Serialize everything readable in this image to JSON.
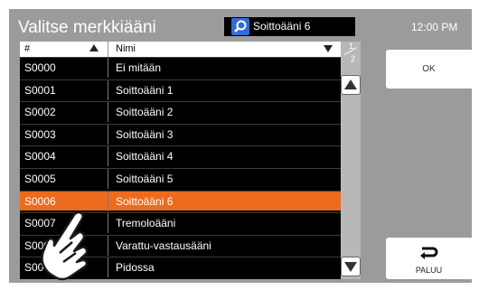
{
  "header": {
    "title": "Valitse merkkiääni",
    "search_value": "Soittoääni 6",
    "time": "12:00 PM"
  },
  "list": {
    "col_id": "#",
    "col_name": "Nimi",
    "rows": [
      {
        "id": "S0000",
        "name": "Ei mitään"
      },
      {
        "id": "S0001",
        "name": "Soittoääni 1"
      },
      {
        "id": "S0002",
        "name": "Soittoääni 2"
      },
      {
        "id": "S0003",
        "name": "Soittoääni 3"
      },
      {
        "id": "S0004",
        "name": "Soittoääni 4"
      },
      {
        "id": "S0005",
        "name": "Soittoääni 5"
      },
      {
        "id": "S0006",
        "name": "Soittoääni 6"
      },
      {
        "id": "S0007",
        "name": "Tremoloääni"
      },
      {
        "id": "S0008",
        "name": "Varattu-vastausääni"
      },
      {
        "id": "S0009",
        "name": "Pidossa"
      }
    ],
    "selected_index": 6
  },
  "pager": {
    "current": "1",
    "total": "2"
  },
  "buttons": {
    "ok": "OK",
    "back": "PALUU"
  },
  "colors": {
    "selected": "#ec6b1e",
    "background": "#9b9b9b"
  },
  "icons": [
    "search-icon",
    "sort-asc-icon",
    "sort-desc-icon",
    "up-arrow-icon",
    "down-arrow-icon",
    "return-icon",
    "pointing-hand-icon"
  ]
}
